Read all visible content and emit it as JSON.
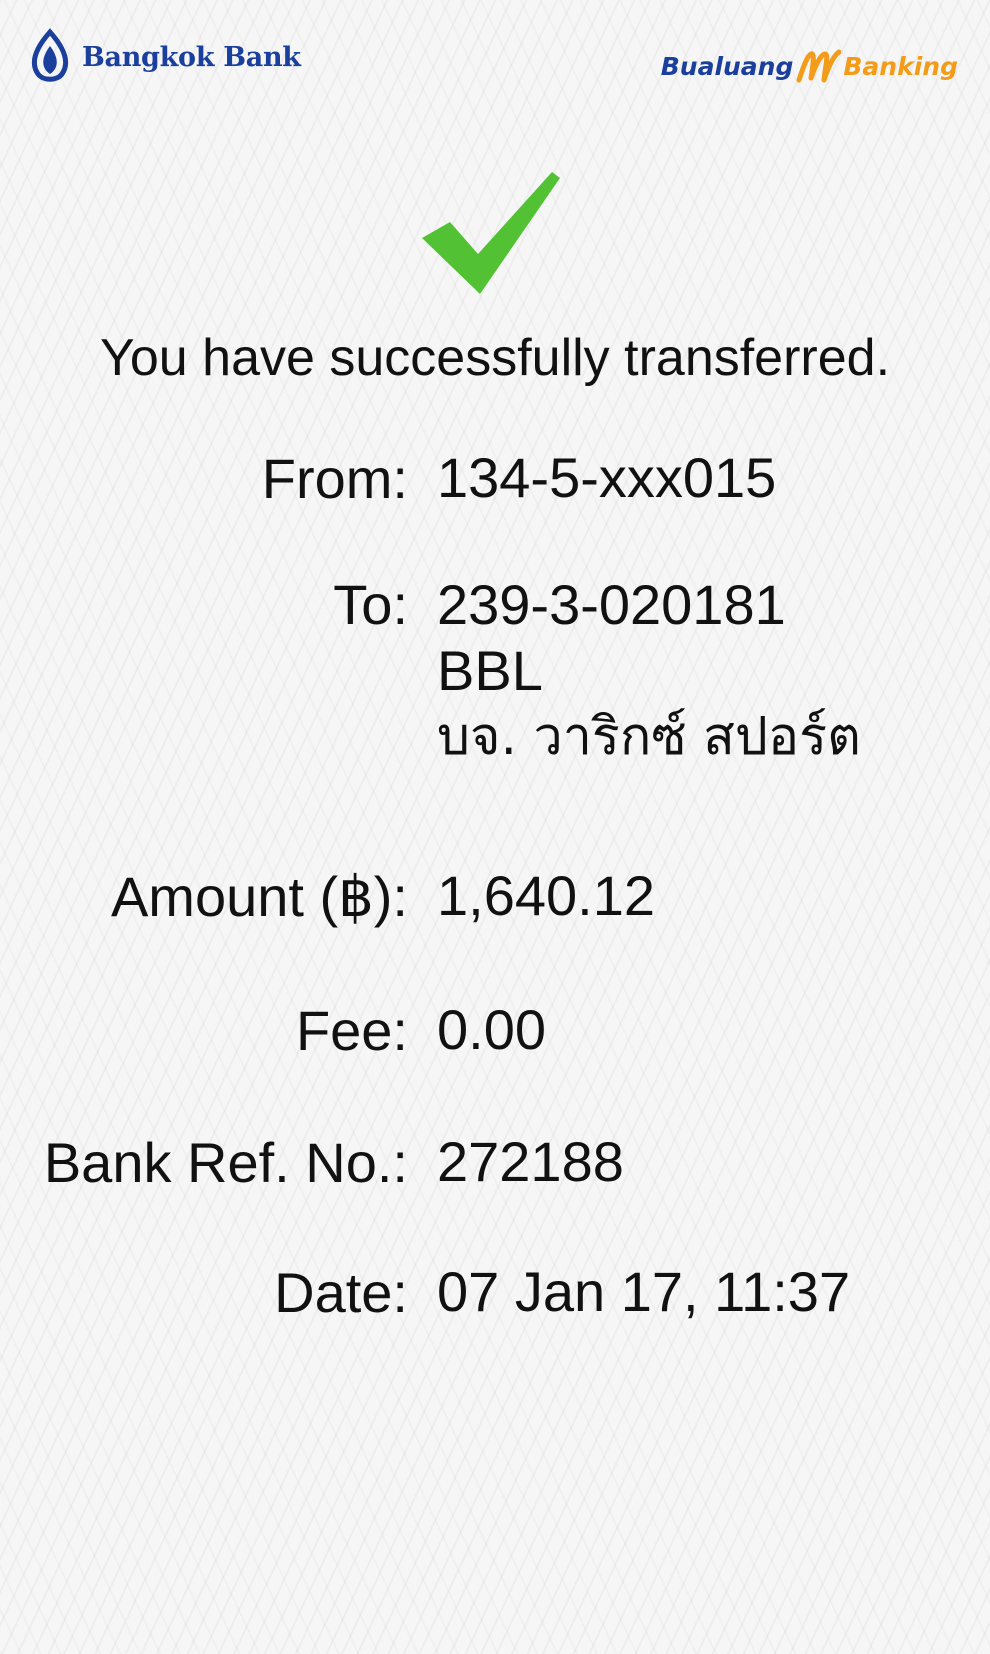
{
  "header": {
    "bank_name": "Bangkok Bank",
    "app_logo_left": "Bualuang",
    "app_logo_right": "Banking",
    "brand_blue": "#1b3f9c",
    "brand_orange": "#f39c1a"
  },
  "status": {
    "icon": "checkmark-icon",
    "icon_color": "#52c234",
    "message": "You have successfully transferred."
  },
  "details": {
    "from_label": "From:",
    "from_value": "134-5-xxx015",
    "to_label": "To:",
    "to_account": "239-3-020181",
    "to_bank": "BBL",
    "to_name": "บจ. วาริกซ์ สปอร์ต",
    "amount_label": "Amount (฿):",
    "amount_value": "1,640.12",
    "fee_label": "Fee:",
    "fee_value": "0.00",
    "ref_label": "Bank Ref. No.:",
    "ref_value": "272188",
    "date_label": "Date:",
    "date_value": "07 Jan 17, 11:37"
  }
}
